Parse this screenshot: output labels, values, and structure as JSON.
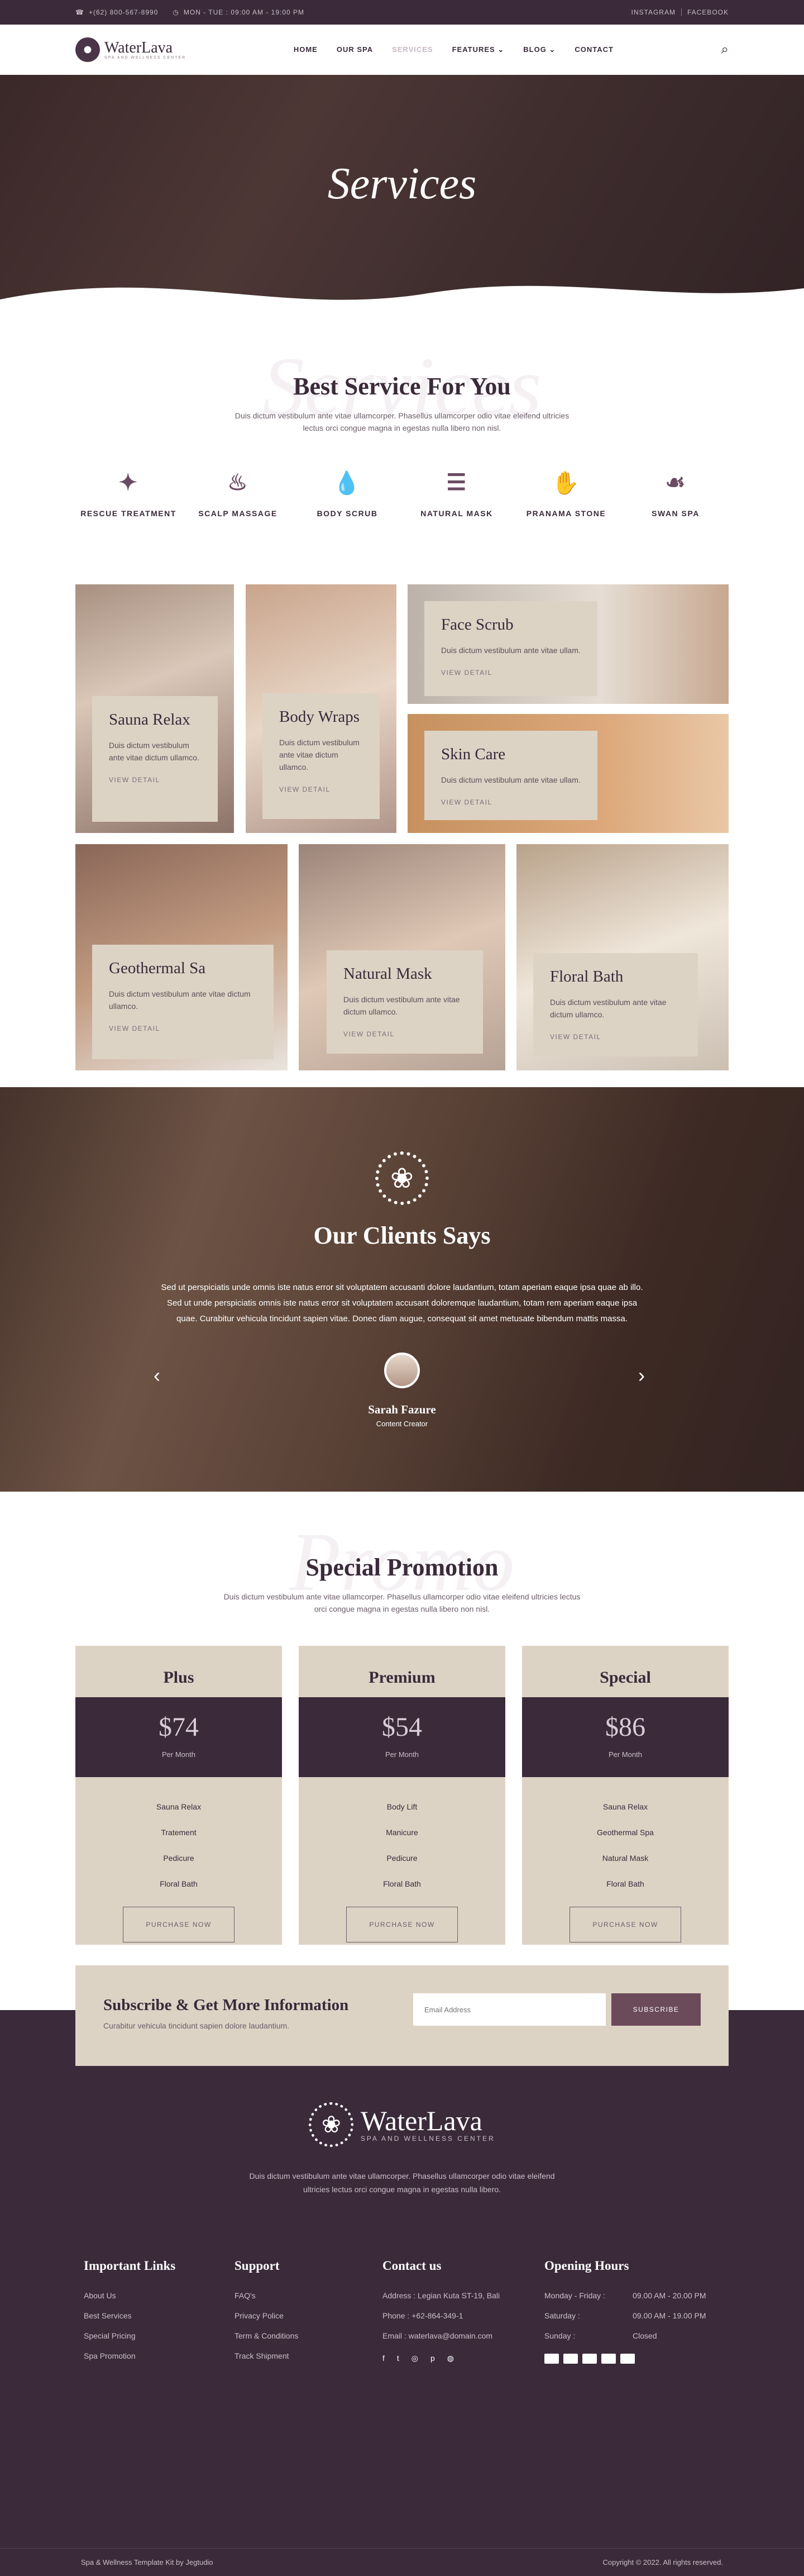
{
  "topbar": {
    "phone": "+(62) 800-567-8990",
    "hours": "MON - TUE : 09:00 AM - 19:00 PM",
    "links": [
      "INSTAGRAM",
      "FACEBOOK"
    ]
  },
  "brand": {
    "name": "WaterLava",
    "tagline": "SPA AND WELLNESS CENTER"
  },
  "nav": {
    "items": [
      "HOME",
      "OUR SPA",
      "SERVICES",
      "FEATURES",
      "BLOG",
      "CONTACT"
    ]
  },
  "hero": {
    "title": "Services"
  },
  "services": {
    "ghost": "Services",
    "title": "Best Service For You",
    "subtitle1": "Duis dictum vestibulum ante vitae ullamcorper. Phasellus ullamcorper odio vitae eleifend ultricies",
    "subtitle2": "lectus orci congue magna in egestas nulla libero non nisl.",
    "icons": [
      {
        "label": "RESCUE TREATMENT",
        "icon": "wand-icon"
      },
      {
        "label": "SCALP MASSAGE",
        "icon": "bottle-icon"
      },
      {
        "label": "BODY SCRUB",
        "icon": "drop-icon"
      },
      {
        "label": "NATURAL MASK",
        "icon": "stones-icon"
      },
      {
        "label": "PRANAMA STONE",
        "icon": "hand-icon"
      },
      {
        "label": "SWAN SPA",
        "icon": "hand-drop-icon"
      }
    ],
    "cards": [
      {
        "title": "Sauna Relax",
        "text": "Duis dictum vestibulum ante vitae dictum ullamco.",
        "link": "VIEW DETAIL"
      },
      {
        "title": "Body Wraps",
        "text": "Duis dictum vestibulum ante vitae dictum ullamco.",
        "link": "VIEW DETAIL"
      },
      {
        "title": "Face Scrub",
        "text": "Duis dictum vestibulum ante vitae ullam.",
        "link": "VIEW DETAIL"
      },
      {
        "title": "Skin Care",
        "text": "Duis dictum vestibulum ante vitae ullam.",
        "link": "VIEW DETAIL"
      },
      {
        "title": "Geothermal Sa",
        "text": "Duis dictum vestibulum ante vitae dictum ullamco.",
        "link": "VIEW DETAIL"
      },
      {
        "title": "Natural Mask",
        "text": "Duis dictum vestibulum ante vitae dictum ullamco.",
        "link": "VIEW DETAIL"
      },
      {
        "title": "Floral Bath",
        "text": "Duis dictum vestibulum ante vitae dictum ullamco.",
        "link": "VIEW DETAIL"
      }
    ]
  },
  "testimonial": {
    "title": "Our Clients Says",
    "line1": "Sed ut perspiciatis unde omnis iste natus error sit voluptatem accusanti dolore laudantium, totam aperiam eaque ipsa quae ab illo.",
    "line2": "Sed ut unde perspiciatis omnis iste natus error sit voluptatem accusant doloremque laudantium, totam rem aperiam eaque ipsa",
    "line3": "quae. Curabitur vehicula tincidunt sapien vitae. Donec diam augue, consequat sit amet metusate bibendum mattis massa.",
    "name": "Sarah Fazure",
    "role": "Content Creator"
  },
  "promo": {
    "ghost": "Promo",
    "title": "Special Promotion",
    "subtitle1": "Duis dictum vestibulum ante vitae ullamcorper. Phasellus ullamcorper odio vitae eleifend ultricies lectus",
    "subtitle2": "orci congue magna in egestas nulla libero non nisl.",
    "plans": [
      {
        "name": "Plus",
        "price": "$74",
        "per": "Per Month",
        "items": [
          "Sauna Relax",
          "Tratement",
          "Pedicure",
          "Floral Bath"
        ],
        "cta": "PURCHASE NOW"
      },
      {
        "name": "Premium",
        "price": "$54",
        "per": "Per Month",
        "items": [
          "Body Lift",
          "Manicure",
          "Pedicure",
          "Floral Bath"
        ],
        "cta": "PURCHASE NOW"
      },
      {
        "name": "Special",
        "price": "$86",
        "per": "Per Month",
        "items": [
          "Sauna Relax",
          "Geothermal Spa",
          "Natural Mask",
          "Floral Bath"
        ],
        "cta": "PURCHASE NOW"
      }
    ]
  },
  "subscribe": {
    "title": "Subscribe & Get More Information",
    "text": "Curabitur vehicula tincidunt sapien dolore laudantium.",
    "placeholder": "Email Address",
    "button": "SUBSCRIBE"
  },
  "footer": {
    "about1": "Duis dictum vestibulum ante vitae ullamcorper. Phasellus ullamcorper odio vitae eleifend",
    "about2": "ultricies lectus orci congue magna in egestas nulla libero.",
    "links_title": "Important Links",
    "links": [
      "About Us",
      "Best Services",
      "Special Pricing",
      "Spa Promotion"
    ],
    "support_title": "Support",
    "support": [
      "FAQ's",
      "Privacy Police",
      "Term & Conditions",
      "Track Shipment"
    ],
    "contact_title": "Contact us",
    "contact": [
      "Address : Legian Kuta ST-19, Bali",
      "Phone : +62-864-349-1",
      "Email : waterlava@domain.com"
    ],
    "hours_title": "Opening Hours",
    "hours": [
      {
        "day": "Monday - Friday :",
        "time": "09.00 AM - 20.00 PM"
      },
      {
        "day": "Saturday :",
        "time": "09.00 AM - 19.00 PM"
      },
      {
        "day": "Sunday :",
        "time": "Closed"
      }
    ],
    "credit": "Spa & Wellness Template Kit by Jegtudio",
    "copyright": "Copyright © 2022. All rights reserved."
  },
  "colors": {
    "plum": "#3a2a3a",
    "sand": "#ddd3c5",
    "accent": "#6b4a5a"
  }
}
